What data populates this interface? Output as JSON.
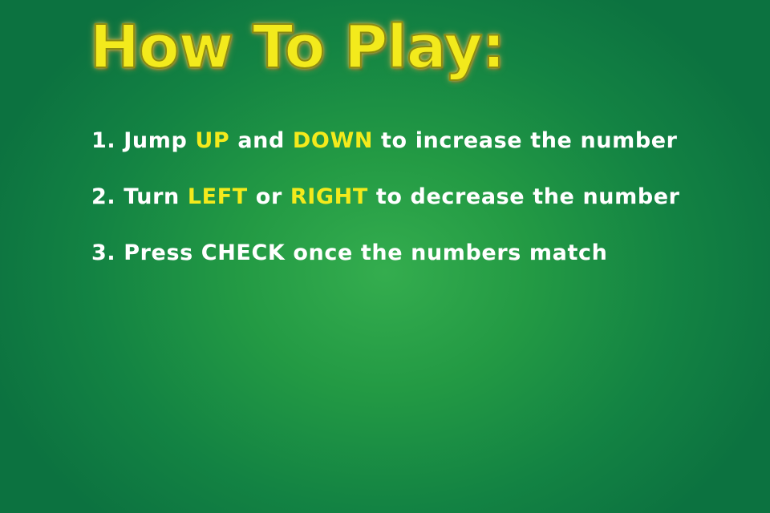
{
  "title": "How To Play:",
  "rules": [
    {
      "number": "1.",
      "parts": [
        "Jump",
        "UP",
        "and",
        "DOWN",
        "to increase the number"
      ]
    },
    {
      "number": "2.",
      "parts": [
        "Turn",
        "LEFT",
        "or",
        "RIGHT",
        "to decrease the number"
      ]
    },
    {
      "number": "3.",
      "parts": [
        "Press CHECK once the numbers match"
      ]
    }
  ],
  "colors": {
    "title": "#f3ea1c",
    "highlight": "#f3ea1c",
    "text": "#ffffff",
    "background": "#138343"
  }
}
